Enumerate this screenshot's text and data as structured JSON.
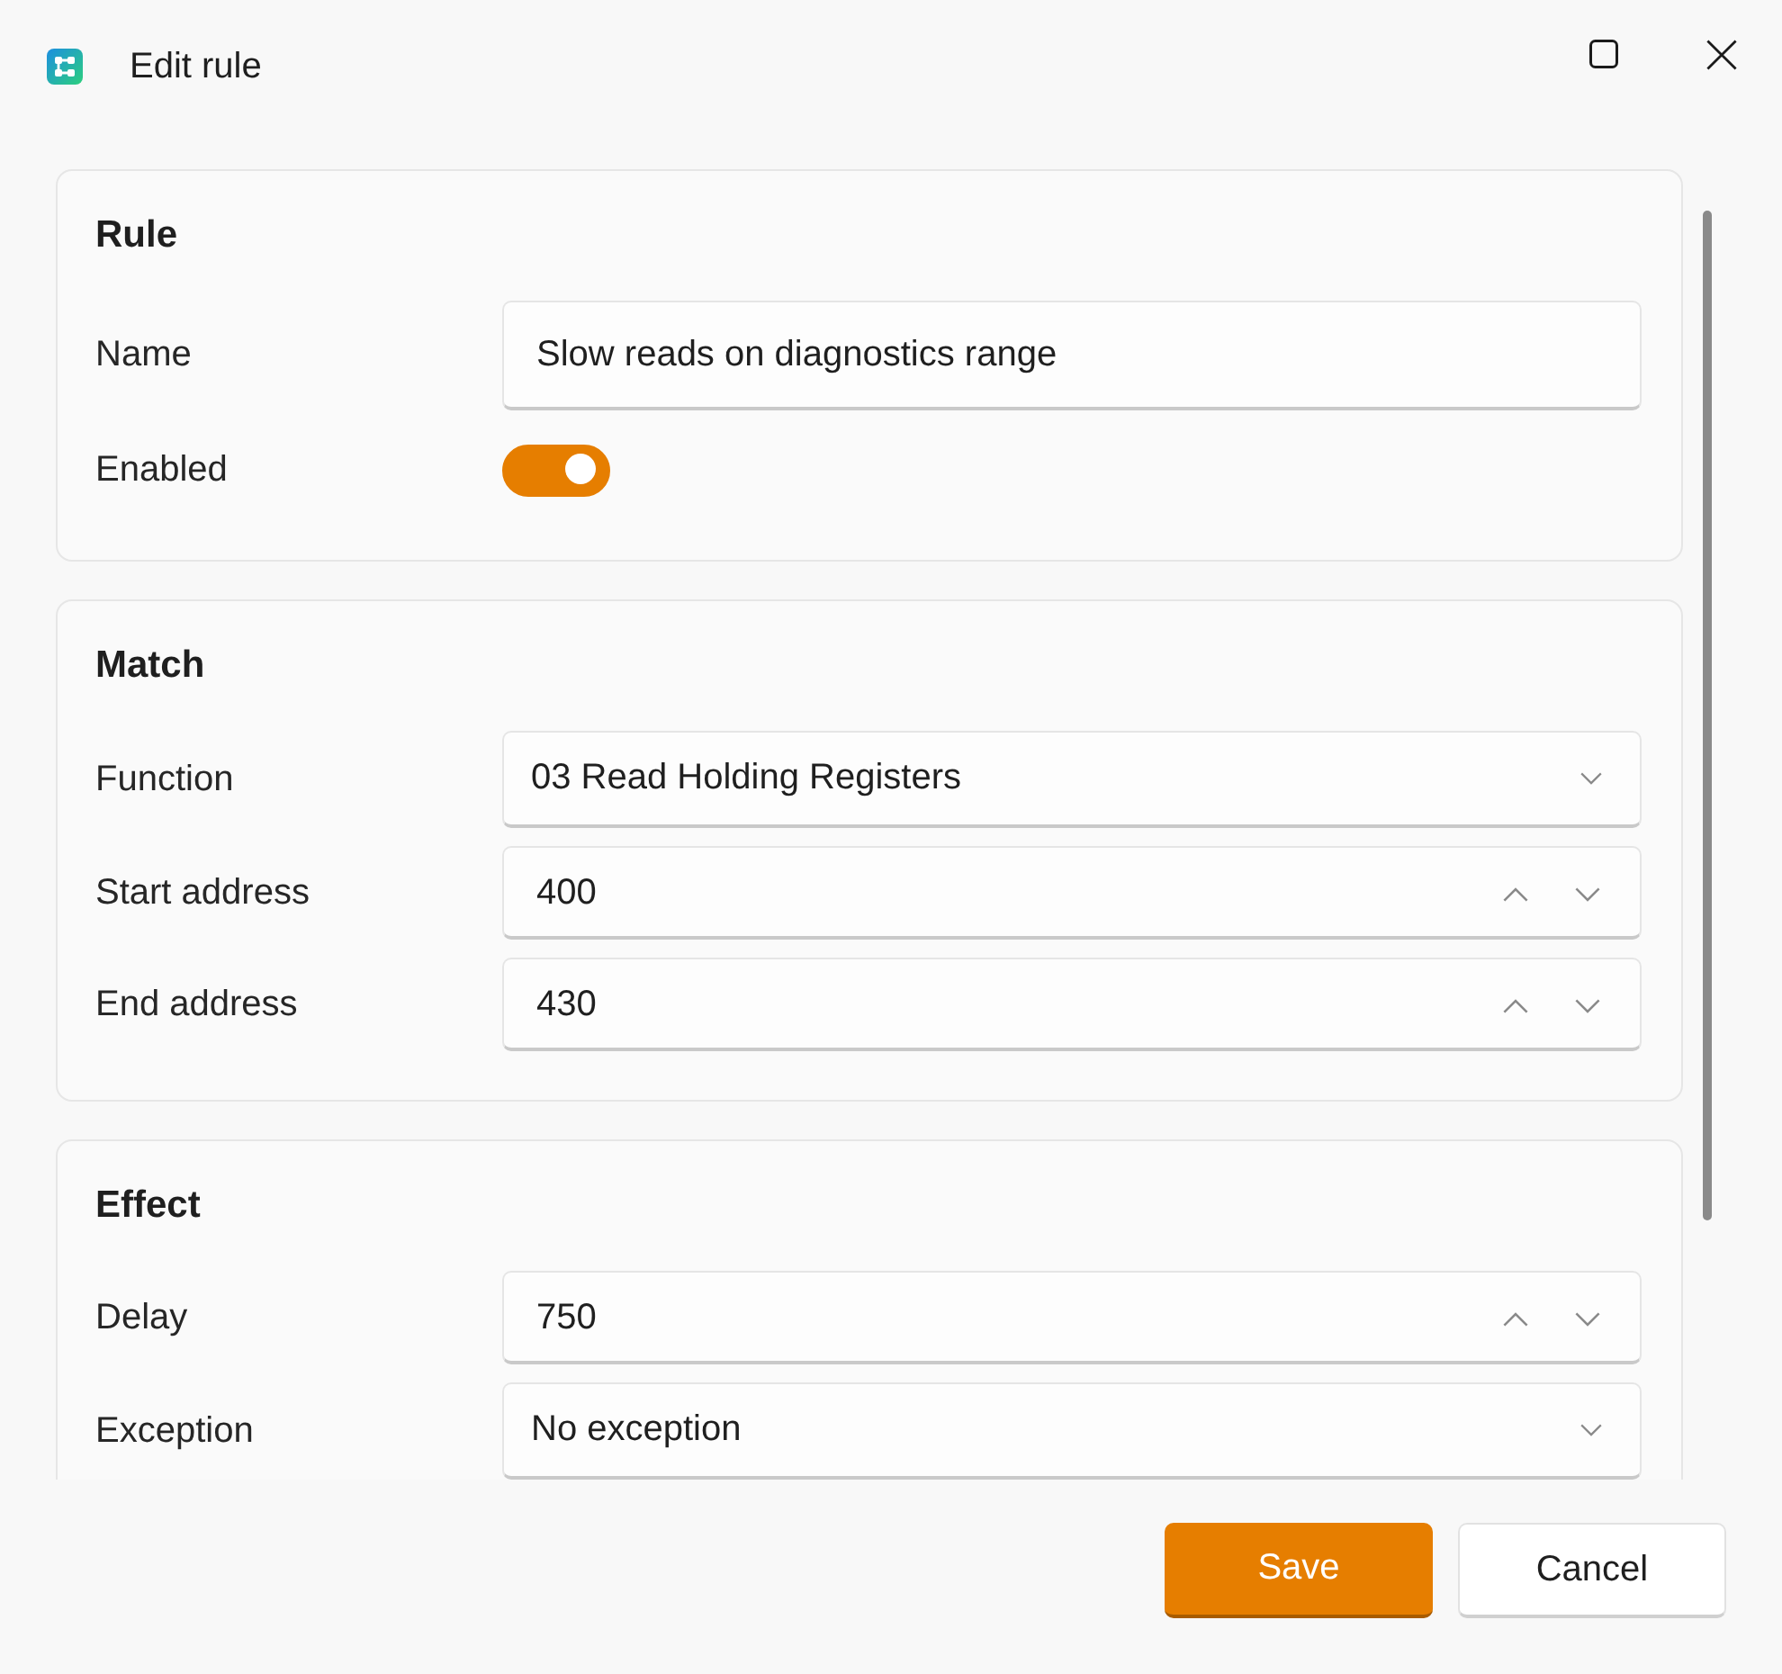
{
  "window": {
    "title": "Edit rule"
  },
  "sections": [
    {
      "title": "Rule",
      "fields": [
        {
          "kind": "text",
          "label": "Name",
          "value": "Slow reads on diagnostics range"
        },
        {
          "kind": "toggle",
          "label": "Enabled",
          "on": true
        }
      ]
    },
    {
      "title": "Match",
      "fields": [
        {
          "kind": "select",
          "label": "Function",
          "value": "03 Read Holding Registers"
        },
        {
          "kind": "number",
          "label": "Start address",
          "value": "400"
        },
        {
          "kind": "number",
          "label": "End address",
          "value": "430"
        }
      ]
    },
    {
      "title": "Effect",
      "fields": [
        {
          "kind": "number",
          "label": "Delay",
          "value": "750"
        },
        {
          "kind": "select",
          "label": "Exception",
          "value": "No exception"
        }
      ]
    }
  ],
  "buttons": [
    {
      "label": "Save",
      "kind": "primary"
    },
    {
      "label": "Cancel",
      "kind": "secondary"
    }
  ]
}
